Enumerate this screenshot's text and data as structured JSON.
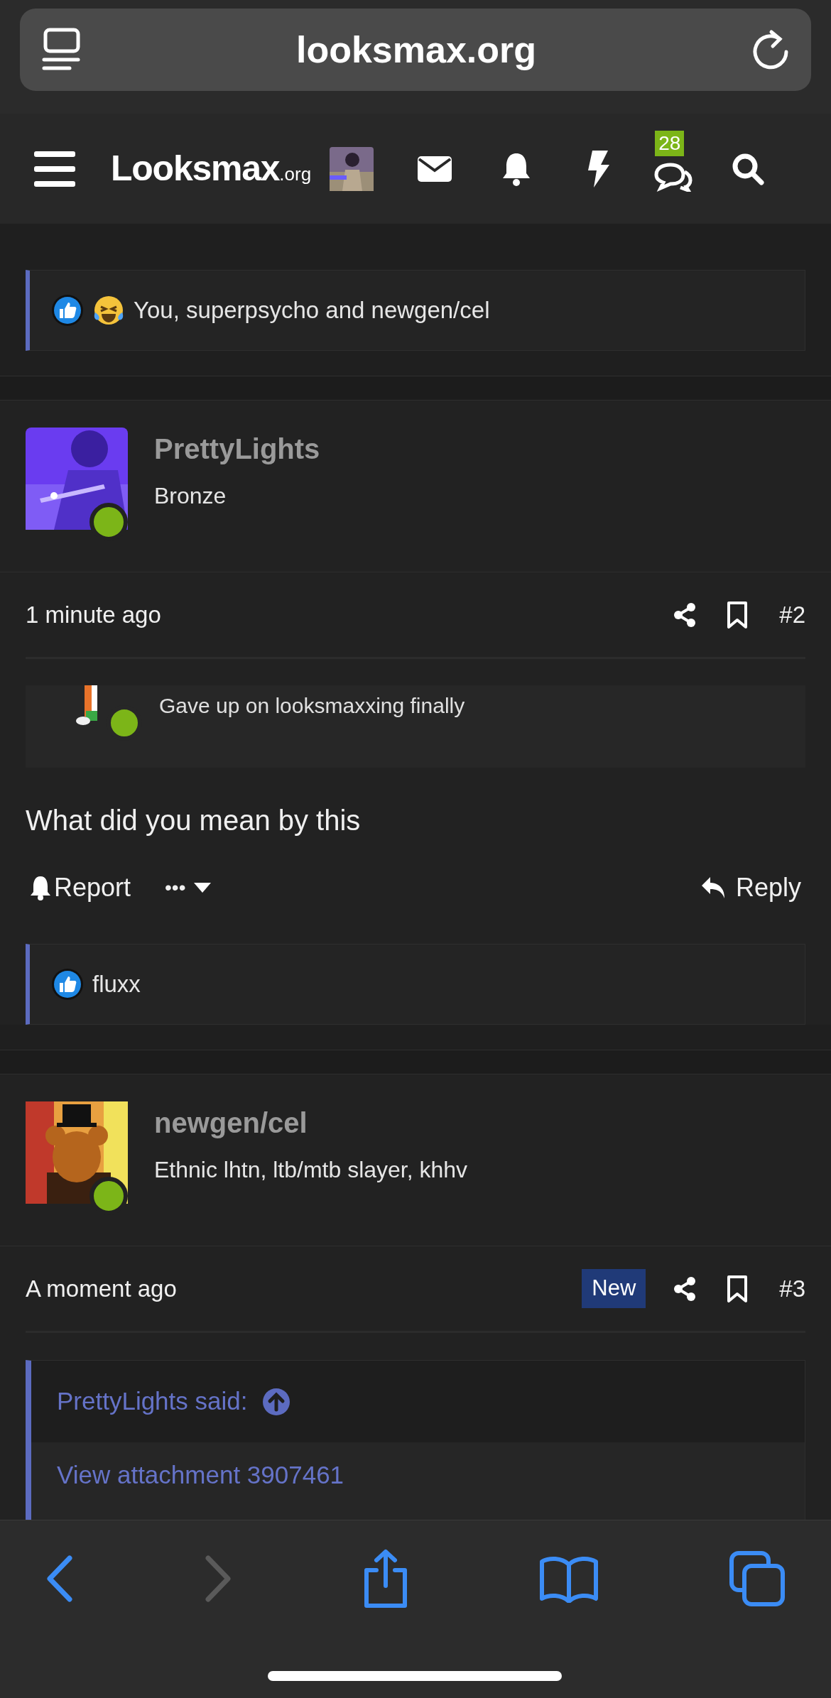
{
  "browser": {
    "url": "looksmax.org"
  },
  "site_header": {
    "logo": "Looksmax",
    "logo_suffix": ".org",
    "conversations_count": "28"
  },
  "top_reactions": {
    "text": "You, superpsycho and newgen/cel"
  },
  "posts": [
    {
      "username": "PrettyLights",
      "user_title": "Bronze",
      "online": true,
      "time": "1 minute ago",
      "new": false,
      "number": "#2",
      "embedded_post": {
        "online": true,
        "text": "Gave up on looksmaxxing finally"
      },
      "body": "What did you mean by this",
      "actions": {
        "report": "Report",
        "more": "•••",
        "reply": "Reply"
      },
      "reactions": {
        "text": "fluxx"
      }
    },
    {
      "username": "newgen/cel",
      "user_title": "Ethnic lhtn, ltb/mtb slayer, khhv",
      "online": true,
      "time": "A moment ago",
      "new": true,
      "new_label": "New",
      "number": "#3",
      "quote": {
        "author": "PrettyLights said:",
        "text": "View attachment 3907461"
      }
    }
  ]
}
